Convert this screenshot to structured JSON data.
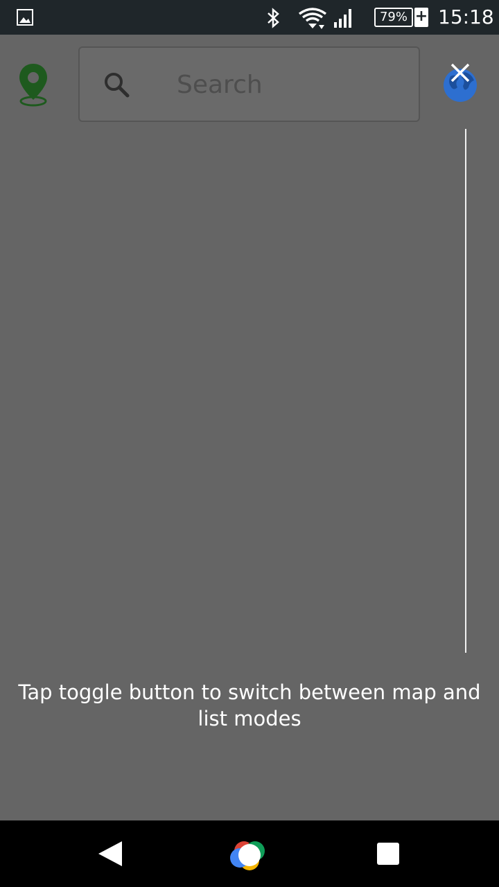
{
  "status_bar": {
    "icons": [
      "gallery-icon",
      "bluetooth-icon",
      "wifi-icon",
      "cell-signal-icon",
      "battery-icon"
    ],
    "battery_label": "79%",
    "charging_symbol": "+",
    "time": "15:18"
  },
  "app_bar": {
    "location_icon": "map-pin-icon",
    "search": {
      "placeholder": "Search",
      "value": "",
      "icon": "search-icon"
    },
    "toggle_icon": "globe-icon",
    "close_icon": "close-icon"
  },
  "hint": {
    "text": "Tap toggle button to switch between map and list modes"
  },
  "nav_bar": {
    "icons": [
      "back-icon",
      "home-icon",
      "recents-icon"
    ]
  },
  "colors": {
    "background": "#656565",
    "status_bar": "#1f262a",
    "pin_green": "#1e5a1e",
    "globe_blue": "#2d6fd0",
    "nav_bar": "#000000"
  }
}
